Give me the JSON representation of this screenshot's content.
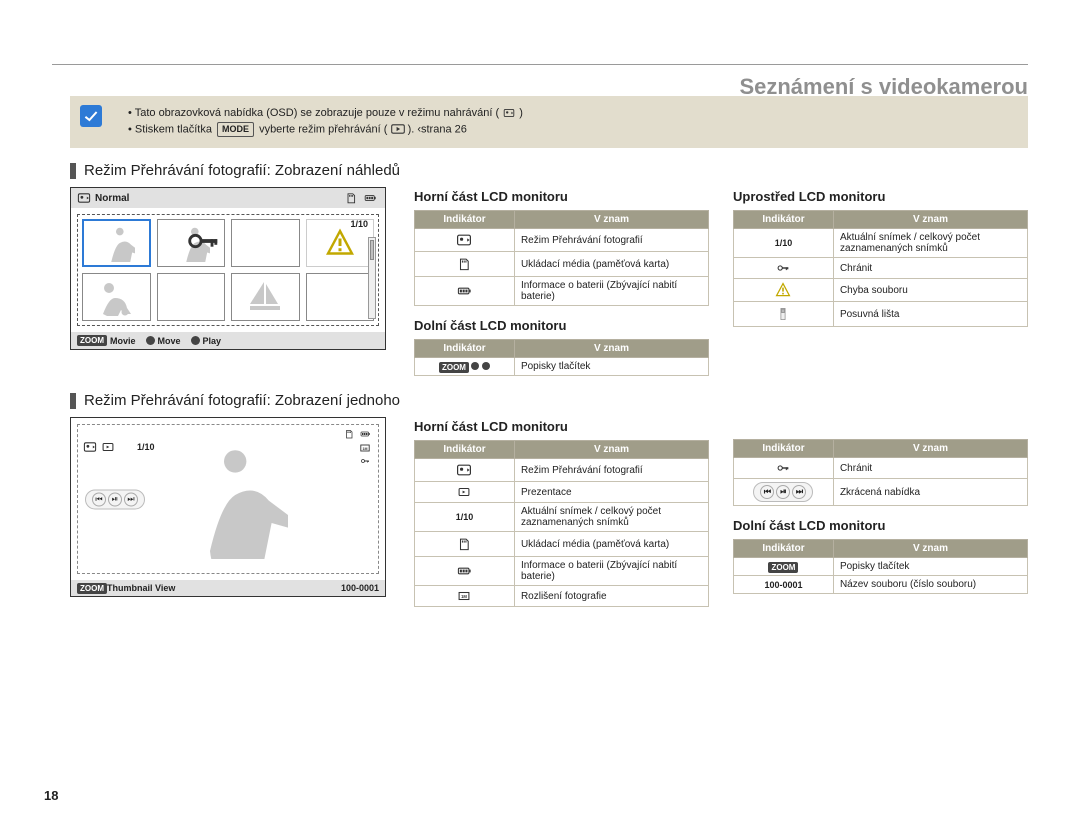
{
  "header": {
    "title": "Seznámení s videokamerou"
  },
  "page_number": "18",
  "note": {
    "bullets": [
      "Tato obrazovková nabídka (OSD) se zobrazuje pouze v režimu nahrávání (",
      "Stiskem tlačítka "
    ],
    "bullets_cont": [
      ")",
      " vyberte režim přehrávání ( "
    ],
    "bullets_tail": [
      "",
      " ).  ‹strana 26"
    ],
    "mode_pill": "MODE"
  },
  "section1": {
    "heading": "Režim Přehrávání fotografií: Zobrazení náhledů",
    "lcd": {
      "top_label": "Normal",
      "count": "1/10",
      "bottom": {
        "zoom_badge": "ZOOM",
        "movie": "Movie",
        "move": "Move",
        "play": "Play"
      }
    },
    "top_heading": "Horní část LCD monitoru",
    "top_table": {
      "h1": "Indikátor",
      "h2": "V znam",
      "rows": [
        {
          "ic": "photo-play-icon",
          "txt": "Režim Přehrávání fotografií"
        },
        {
          "ic": "sd-card-icon",
          "txt": "Ukládací média (paměťová karta)"
        },
        {
          "ic": "battery-icon",
          "txt": "Informace o baterii (Zbývající nabití baterie)"
        }
      ]
    },
    "bot_heading": "Dolní část LCD monitoru",
    "bot_table": {
      "h1": "Indikátor",
      "h2": "V znam",
      "rows": [
        {
          "ic": "zoom-badges-icon",
          "txt": "Popisky tlačítek"
        }
      ]
    },
    "mid_heading": "Uprostřed LCD monitoru",
    "mid_table": {
      "h1": "Indikátor",
      "h2": "V znam",
      "rows": [
        {
          "ic_text": "1/10",
          "txt": "Aktuální snímek / celkový počet zaznamenaných snímků"
        },
        {
          "ic": "key-icon",
          "txt": "Chránit"
        },
        {
          "ic": "warning-icon",
          "txt": "Chyba souboru"
        },
        {
          "ic": "scrollbar-icon",
          "txt": "Posuvná lišta"
        }
      ]
    }
  },
  "section2": {
    "heading": "Režim Přehrávání fotografií: Zobrazení jednoho",
    "lcd": {
      "count": "1/10",
      "bottom": {
        "zoom_badge": "ZOOM",
        "thumb": "Thumbnail View",
        "file": "100-0001"
      }
    },
    "left_heading": "Horní část LCD monitoru",
    "left_table": {
      "h1": "Indikátor",
      "h2": "V znam",
      "rows": [
        {
          "ic": "photo-play-icon",
          "txt": "Režim Přehrávání fotografií"
        },
        {
          "ic": "slideshow-icon",
          "txt": "Prezentace"
        },
        {
          "ic_text": "1/10",
          "txt": "Aktuální snímek / celkový počet zaznamenaných snímků"
        },
        {
          "ic": "sd-card-icon",
          "txt": "Ukládací média (paměťová karta)"
        },
        {
          "ic": "battery-icon",
          "txt": "Informace o baterii (Zbývající nabití baterie)"
        },
        {
          "ic": "resolution-icon",
          "txt": "Rozlišení fotografie"
        }
      ]
    },
    "right_top_table": {
      "h1": "Indikátor",
      "h2": "V znam",
      "rows": [
        {
          "ic": "key-icon",
          "txt": "Chránit"
        },
        {
          "ic": "nav-cluster-icon",
          "txt": "Zkrácená nabídka"
        }
      ]
    },
    "right_heading": "Dolní část LCD monitoru",
    "right_bot_table": {
      "h1": "Indikátor",
      "h2": "V znam",
      "rows": [
        {
          "ic": "zoom-badge-icon",
          "txt": "Popisky tlačítek"
        },
        {
          "ic_text": "100-0001",
          "txt": "Název souboru (číslo souboru)"
        }
      ]
    }
  }
}
